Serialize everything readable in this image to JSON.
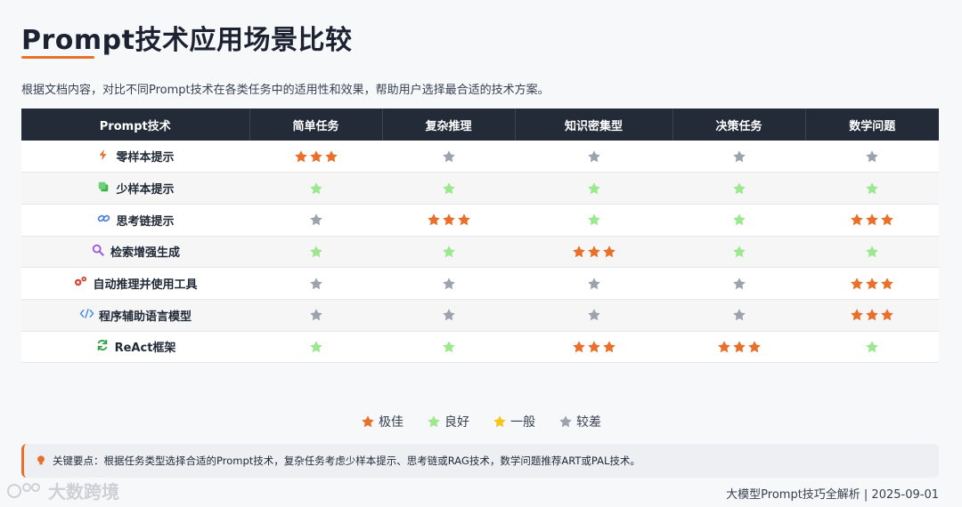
{
  "page": {
    "title": "Prompt技术应用场景比较",
    "intro": "根据文档内容，对比不同Prompt技术在各类任务中的适用性和效果，帮助用户选择最合适的技术方案。"
  },
  "table": {
    "headers": [
      "Prompt技术",
      "简单任务",
      "复杂推理",
      "知识密集型",
      "决策任务",
      "数学问题"
    ],
    "rows": [
      {
        "tech": "零样本提示",
        "icon": "lightning-icon",
        "ratings": [
          "excellent",
          "poor",
          "poor",
          "poor",
          "poor"
        ]
      },
      {
        "tech": "少样本提示",
        "icon": "copy-icon",
        "ratings": [
          "good",
          "good",
          "good",
          "good",
          "good"
        ]
      },
      {
        "tech": "思考链提示",
        "icon": "link-icon",
        "ratings": [
          "poor",
          "excellent",
          "good",
          "good",
          "excellent"
        ]
      },
      {
        "tech": "检索增强生成",
        "icon": "search-icon",
        "ratings": [
          "good",
          "good",
          "excellent",
          "good",
          "good"
        ]
      },
      {
        "tech": "自动推理并使用工具",
        "icon": "gears-icon",
        "ratings": [
          "poor",
          "poor",
          "poor",
          "poor",
          "excellent"
        ]
      },
      {
        "tech": "程序辅助语言模型",
        "icon": "code-icon",
        "ratings": [
          "poor",
          "poor",
          "poor",
          "poor",
          "excellent"
        ]
      },
      {
        "tech": "ReAct框架",
        "icon": "refresh-icon",
        "ratings": [
          "good",
          "good",
          "excellent",
          "excellent",
          "good"
        ]
      }
    ]
  },
  "legend": [
    {
      "key": "excellent",
      "label": "极佳"
    },
    {
      "key": "good",
      "label": "良好"
    },
    {
      "key": "fair",
      "label": "一般"
    },
    {
      "key": "poor",
      "label": "较差"
    }
  ],
  "colors": {
    "excellent": "#e8702a",
    "good": "#9be88e",
    "fair": "#f5c518",
    "poor": "#9ca3af",
    "accent": "#e8702a",
    "header_bg": "#232a38"
  },
  "note": {
    "text": "关键要点：根据任务类型选择合适的Prompt技术，复杂任务考虑少样本提示、思考链或RAG技术，数学问题推荐ART或PAL技术。"
  },
  "watermark": {
    "text": "大数跨境"
  },
  "footer": {
    "text": "大模型Prompt技巧全解析 | 2025-09-01"
  }
}
